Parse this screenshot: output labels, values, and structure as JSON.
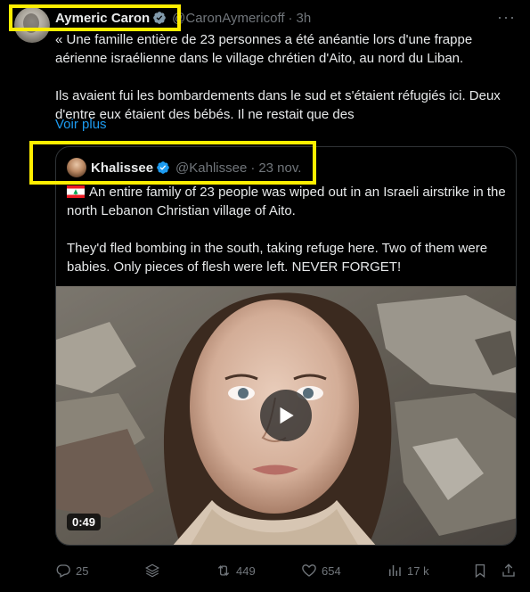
{
  "tweet": {
    "author_name": "Aymeric Caron",
    "handle": "@CaronAymericoff",
    "separator": "·",
    "time": "3h",
    "more_label": "···",
    "text_p1": "« Une famille entière de 23 personnes a été anéantie lors d'une frappe aérienne israélienne dans le village chrétien d'Aito, au nord du Liban.",
    "text_p2": "Ils avaient fui les bombardements dans le sud et s'étaient réfugiés ici. Deux d'entre eux étaient des bébés. Il ne restait que des",
    "see_more": "Voir plus"
  },
  "quoted": {
    "author_name": "Khalissee",
    "handle": "@Kahlissee",
    "separator": "·",
    "date": "23 nov.",
    "text_p1": "An entire family of 23 people was wiped out in an Israeli airstrike in the north Lebanon Christian village of Aito.",
    "text_p2": "They'd fled bombing in the south, taking refuge here. Two of them were babies. Only pieces of flesh were left. NEVER FORGET!",
    "video_duration": "0:49"
  },
  "actions": {
    "replies": "25",
    "reposts": "449",
    "likes": "654",
    "views": "17 k"
  },
  "colors": {
    "background": "#000000",
    "text": "#e7e9ea",
    "secondary": "#71767b",
    "link": "#1d9bf0",
    "verified_blue": "#1d9bf0",
    "verified_gray": "#829aab",
    "highlight": "#ffee00"
  },
  "icons": [
    "verified-badge-icon",
    "more-icon",
    "lebanon-flag-icon",
    "play-icon",
    "reply-icon",
    "grok-icon",
    "repost-icon",
    "like-icon",
    "views-icon",
    "bookmark-icon",
    "share-icon"
  ]
}
